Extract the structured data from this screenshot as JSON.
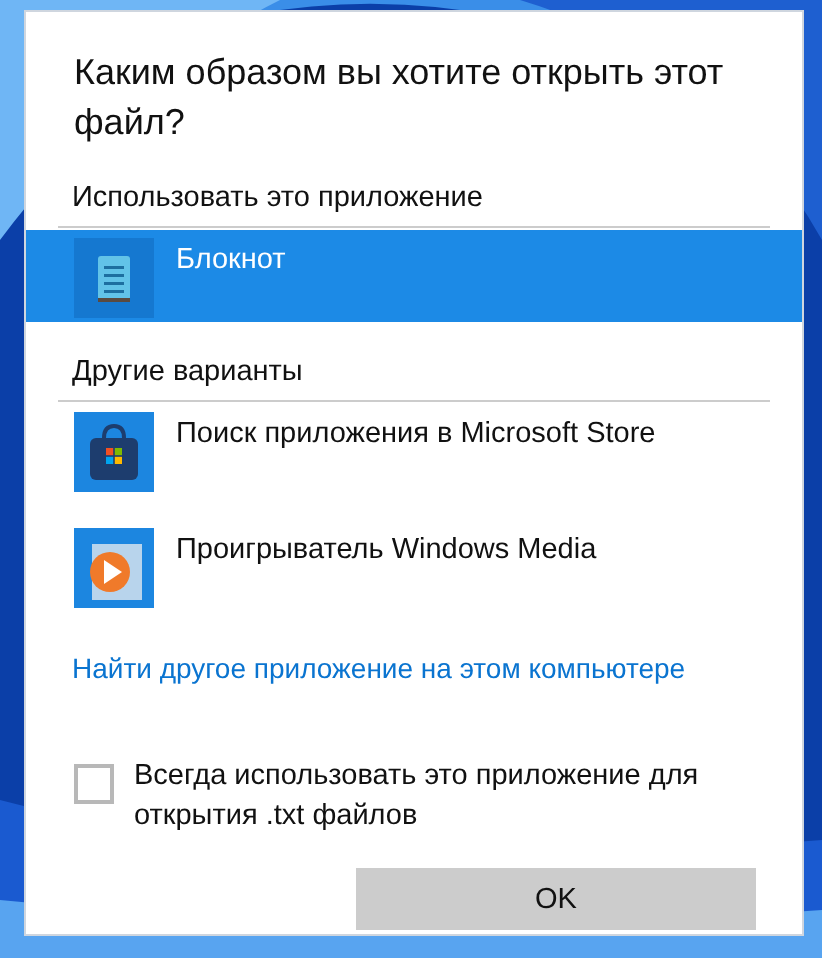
{
  "dialog": {
    "title": "Каким образом вы хотите открыть этот файл?",
    "sections": [
      {
        "heading": "Использовать это приложение",
        "apps": [
          {
            "name": "Блокнот",
            "selected": true
          }
        ]
      },
      {
        "heading": "Другие варианты",
        "apps": [
          {
            "name": "Поиск приложения в Microsoft Store",
            "selected": false
          },
          {
            "name": "Проигрыватель Windows Media",
            "selected": false
          }
        ]
      }
    ],
    "link": "Найти другое приложение на этом компьютере",
    "checkbox": {
      "label": "Всегда использовать это приложение для открытия .txt файлов",
      "checked": false
    },
    "buttons": [
      {
        "label": "OK"
      }
    ]
  }
}
